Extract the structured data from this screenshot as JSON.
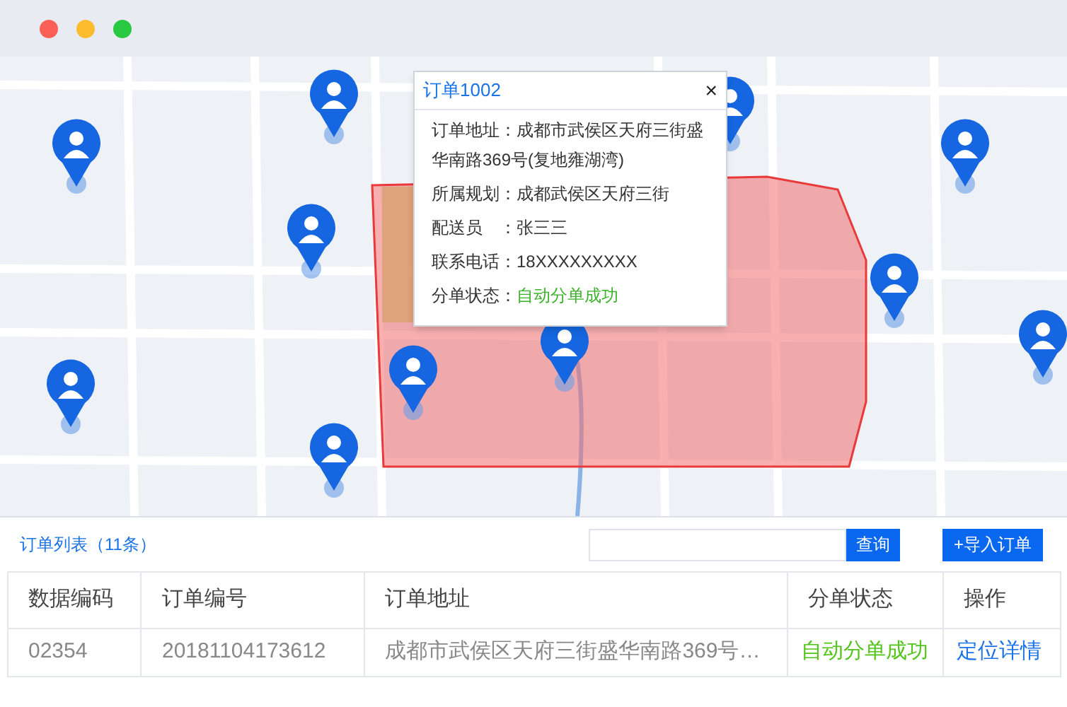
{
  "popup": {
    "title": "订单1002",
    "close": "×",
    "fields": [
      {
        "label": "订单地址：",
        "value": "成都市武侯区天府三街盛华南路369号(复地雍湖湾)",
        "kind": "text"
      },
      {
        "label": "所属规划：",
        "value": "成都武侯区天府三街",
        "kind": "text"
      },
      {
        "label": "配送员　：",
        "value": "张三三",
        "kind": "text"
      },
      {
        "label": "联系电话：",
        "value": "18XXXXXXXXX",
        "kind": "text"
      },
      {
        "label": "分单状态：",
        "value": "自动分单成功",
        "kind": "status"
      }
    ]
  },
  "order_list": {
    "title": "订单列表（11条）",
    "search_button": "查询",
    "import_button": "+导入订单"
  },
  "table": {
    "columns": [
      "数据编码",
      "订单编号",
      "订单地址",
      "分单状态",
      "操作"
    ],
    "rows": [
      {
        "cells": [
          "02354",
          "20181104173612",
          "成都市武侯区天府三街盛华南路369号…",
          "自动分单成功",
          "定位详情"
        ]
      }
    ]
  }
}
